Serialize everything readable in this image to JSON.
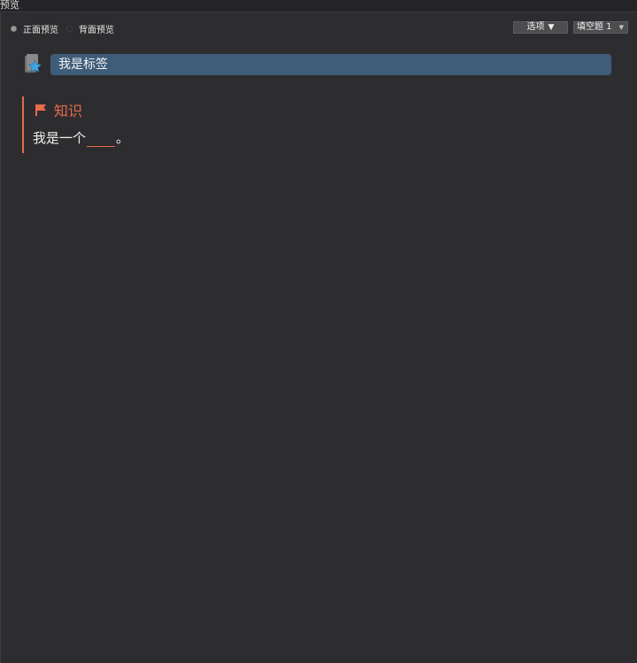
{
  "window": {
    "title": "预览"
  },
  "toolbar": {
    "front_preview": "正面预览",
    "back_preview": "背面预览",
    "options_label": "选项",
    "options_arrow": "▼",
    "card_type_selected": "填空题 1"
  },
  "tag": {
    "text": "我是标签"
  },
  "card": {
    "heading": "知识",
    "text_before": "我是一个",
    "text_after": "。"
  },
  "colors": {
    "background": "#2d2d30",
    "tag_bar": "#3f5c79",
    "accent": "#e06a4e"
  },
  "icons": {
    "tag": "star-tag-icon",
    "heading": "flag-icon",
    "select": "caret-down-icon"
  }
}
